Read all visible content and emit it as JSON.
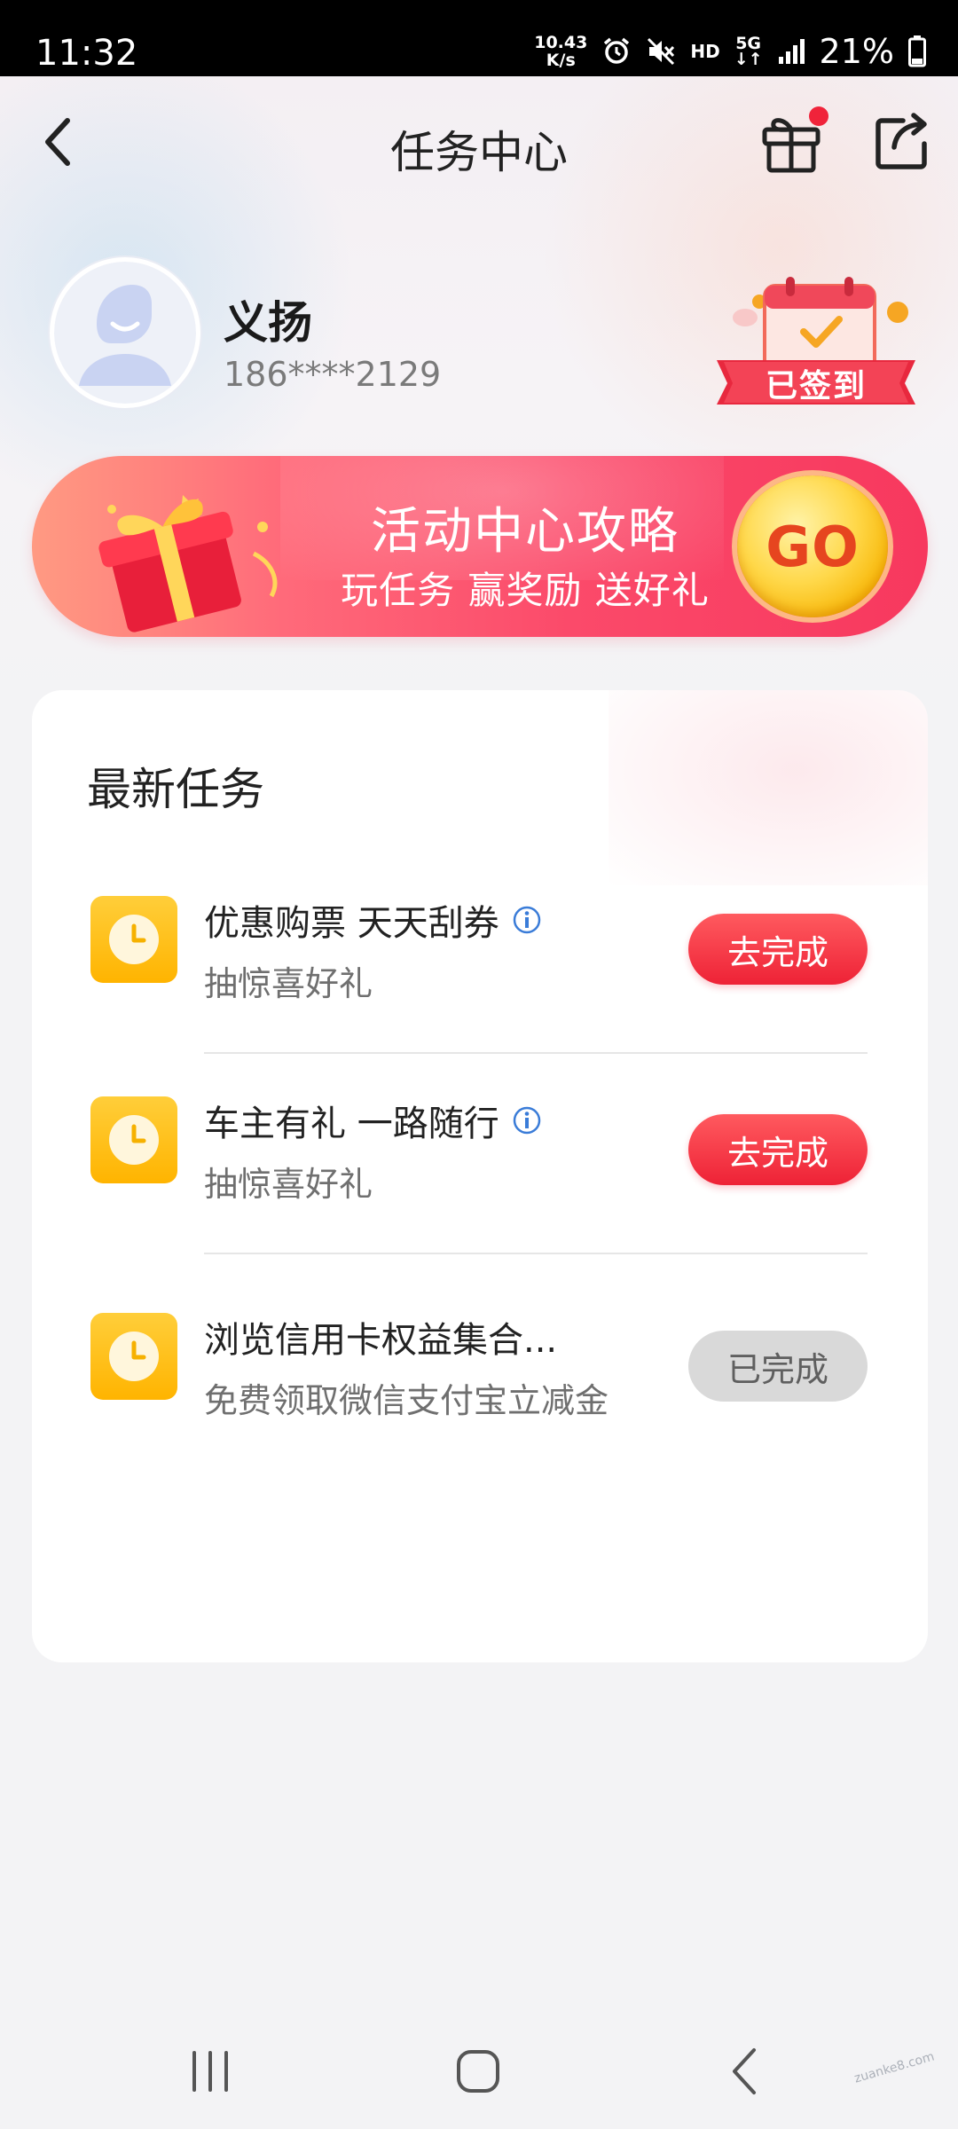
{
  "status_bar": {
    "time": "11:32",
    "net_speed_value": "10.43",
    "net_speed_unit": "K/s",
    "hd": "HD",
    "network": "5G",
    "battery": "21%"
  },
  "header": {
    "title": "任务中心",
    "gift_has_notification": true
  },
  "profile": {
    "name": "义扬",
    "phone": "186****2129",
    "checkin_label": "已签到"
  },
  "banner": {
    "title": "活动中心攻略",
    "subtitle": "玩任务 赢奖励 送好礼",
    "go_label": "GO"
  },
  "tasks_section": {
    "title": "最新任务",
    "items": [
      {
        "title": "优惠购票 天天刮券",
        "has_info": true,
        "desc": "抽惊喜好礼",
        "button": "去完成",
        "status": "pending"
      },
      {
        "title": "车主有礼 一路随行",
        "has_info": true,
        "desc": "抽惊喜好礼",
        "button": "去完成",
        "status": "pending"
      },
      {
        "title": "浏览信用卡权益集合...",
        "has_info": false,
        "desc": "免费领取微信支付宝立减金",
        "button": "已完成",
        "status": "done"
      }
    ]
  },
  "colors": {
    "accent_red": "#ee2236",
    "task_icon_yellow": "#ffb400",
    "done_gray": "#d9d9d9"
  },
  "watermark": "zuanke8.com"
}
